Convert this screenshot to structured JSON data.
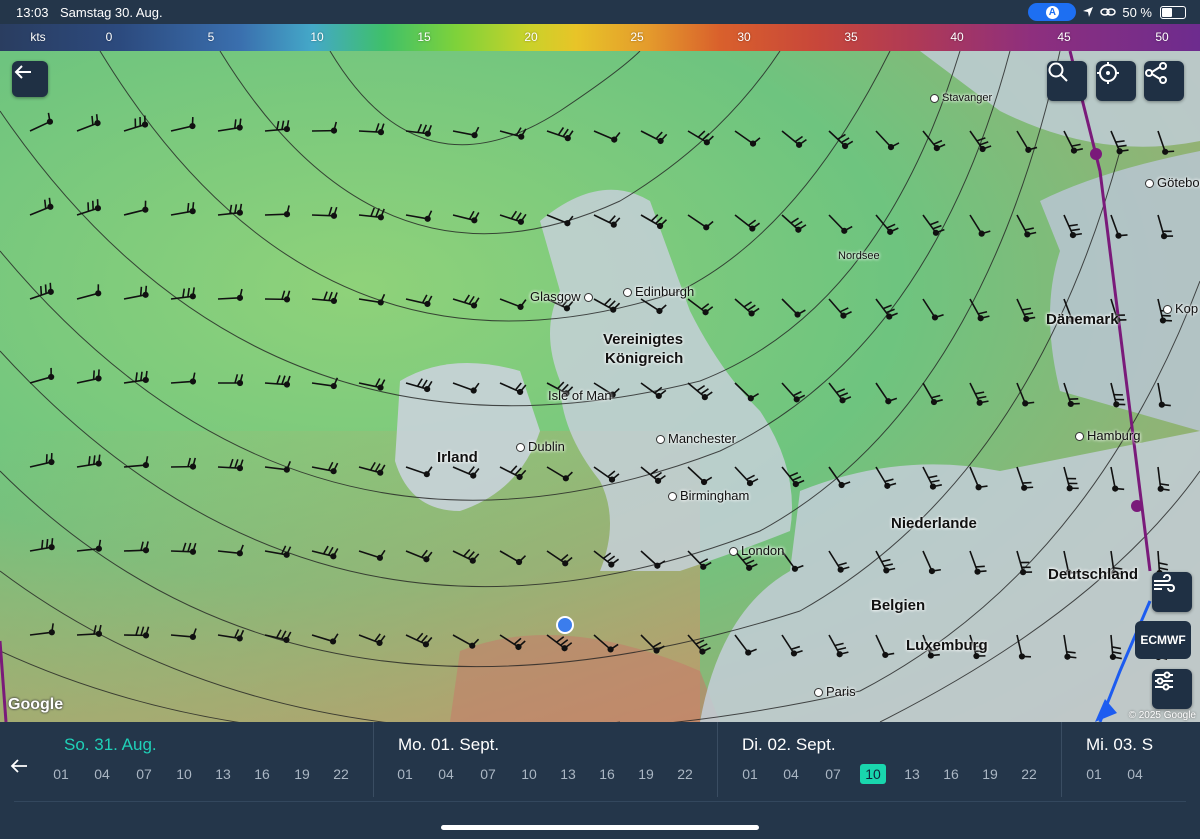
{
  "status_bar": {
    "time": "13:03",
    "date": "Samstag 30. Aug.",
    "battery": "50 %"
  },
  "legend": {
    "unit": "kts",
    "ticks": [
      "0",
      "5",
      "10",
      "15",
      "20",
      "25",
      "30",
      "35",
      "40",
      "45",
      "50"
    ]
  },
  "map": {
    "labels": [
      {
        "text": "Stavanger",
        "type": "city-small"
      },
      {
        "text": "Göteborg",
        "type": "city"
      },
      {
        "text": "Kop",
        "type": "city"
      },
      {
        "text": "Nordsee",
        "type": "sea"
      },
      {
        "text": "Edinburgh",
        "type": "city"
      },
      {
        "text": "Glasgow",
        "type": "city"
      },
      {
        "text": "Vereinigtes",
        "type": "country"
      },
      {
        "text": "Königreich",
        "type": "country"
      },
      {
        "text": "Isle of Man",
        "type": "region"
      },
      {
        "text": "Dänemark",
        "type": "country"
      },
      {
        "text": "Hamburg",
        "type": "city"
      },
      {
        "text": "Irland",
        "type": "country"
      },
      {
        "text": "Dublin",
        "type": "city"
      },
      {
        "text": "Manchester",
        "type": "city"
      },
      {
        "text": "Birmingham",
        "type": "city"
      },
      {
        "text": "Niederlande",
        "type": "country"
      },
      {
        "text": "London",
        "type": "city"
      },
      {
        "text": "Deutschland",
        "type": "country"
      },
      {
        "text": "Belgien",
        "type": "country"
      },
      {
        "text": "Luxemburg",
        "type": "country"
      },
      {
        "text": "Paris",
        "type": "city"
      }
    ],
    "model_button": "ECMWF",
    "attribution_logo": "Google",
    "copyright": "© 2025 Google"
  },
  "timeline": {
    "days": [
      {
        "label": "So. 31. Aug.",
        "active": true,
        "hours": [
          "01",
          "04",
          "07",
          "10",
          "13",
          "16",
          "19",
          "22"
        ]
      },
      {
        "label": "Mo. 01. Sept.",
        "active": false,
        "hours": [
          "01",
          "04",
          "07",
          "10",
          "13",
          "16",
          "19",
          "22"
        ]
      },
      {
        "label": "Di. 02. Sept.",
        "active": false,
        "hours": [
          "01",
          "04",
          "07",
          "10",
          "13",
          "16",
          "19",
          "22"
        ],
        "selected_hour": "10"
      },
      {
        "label": "Mi. 03. S",
        "active": false,
        "hours": [
          "01",
          "04"
        ]
      }
    ]
  },
  "colors": {
    "active_day": "#1fd1b8",
    "selected_hour": "#19d6ad",
    "panel": "#24364a"
  }
}
